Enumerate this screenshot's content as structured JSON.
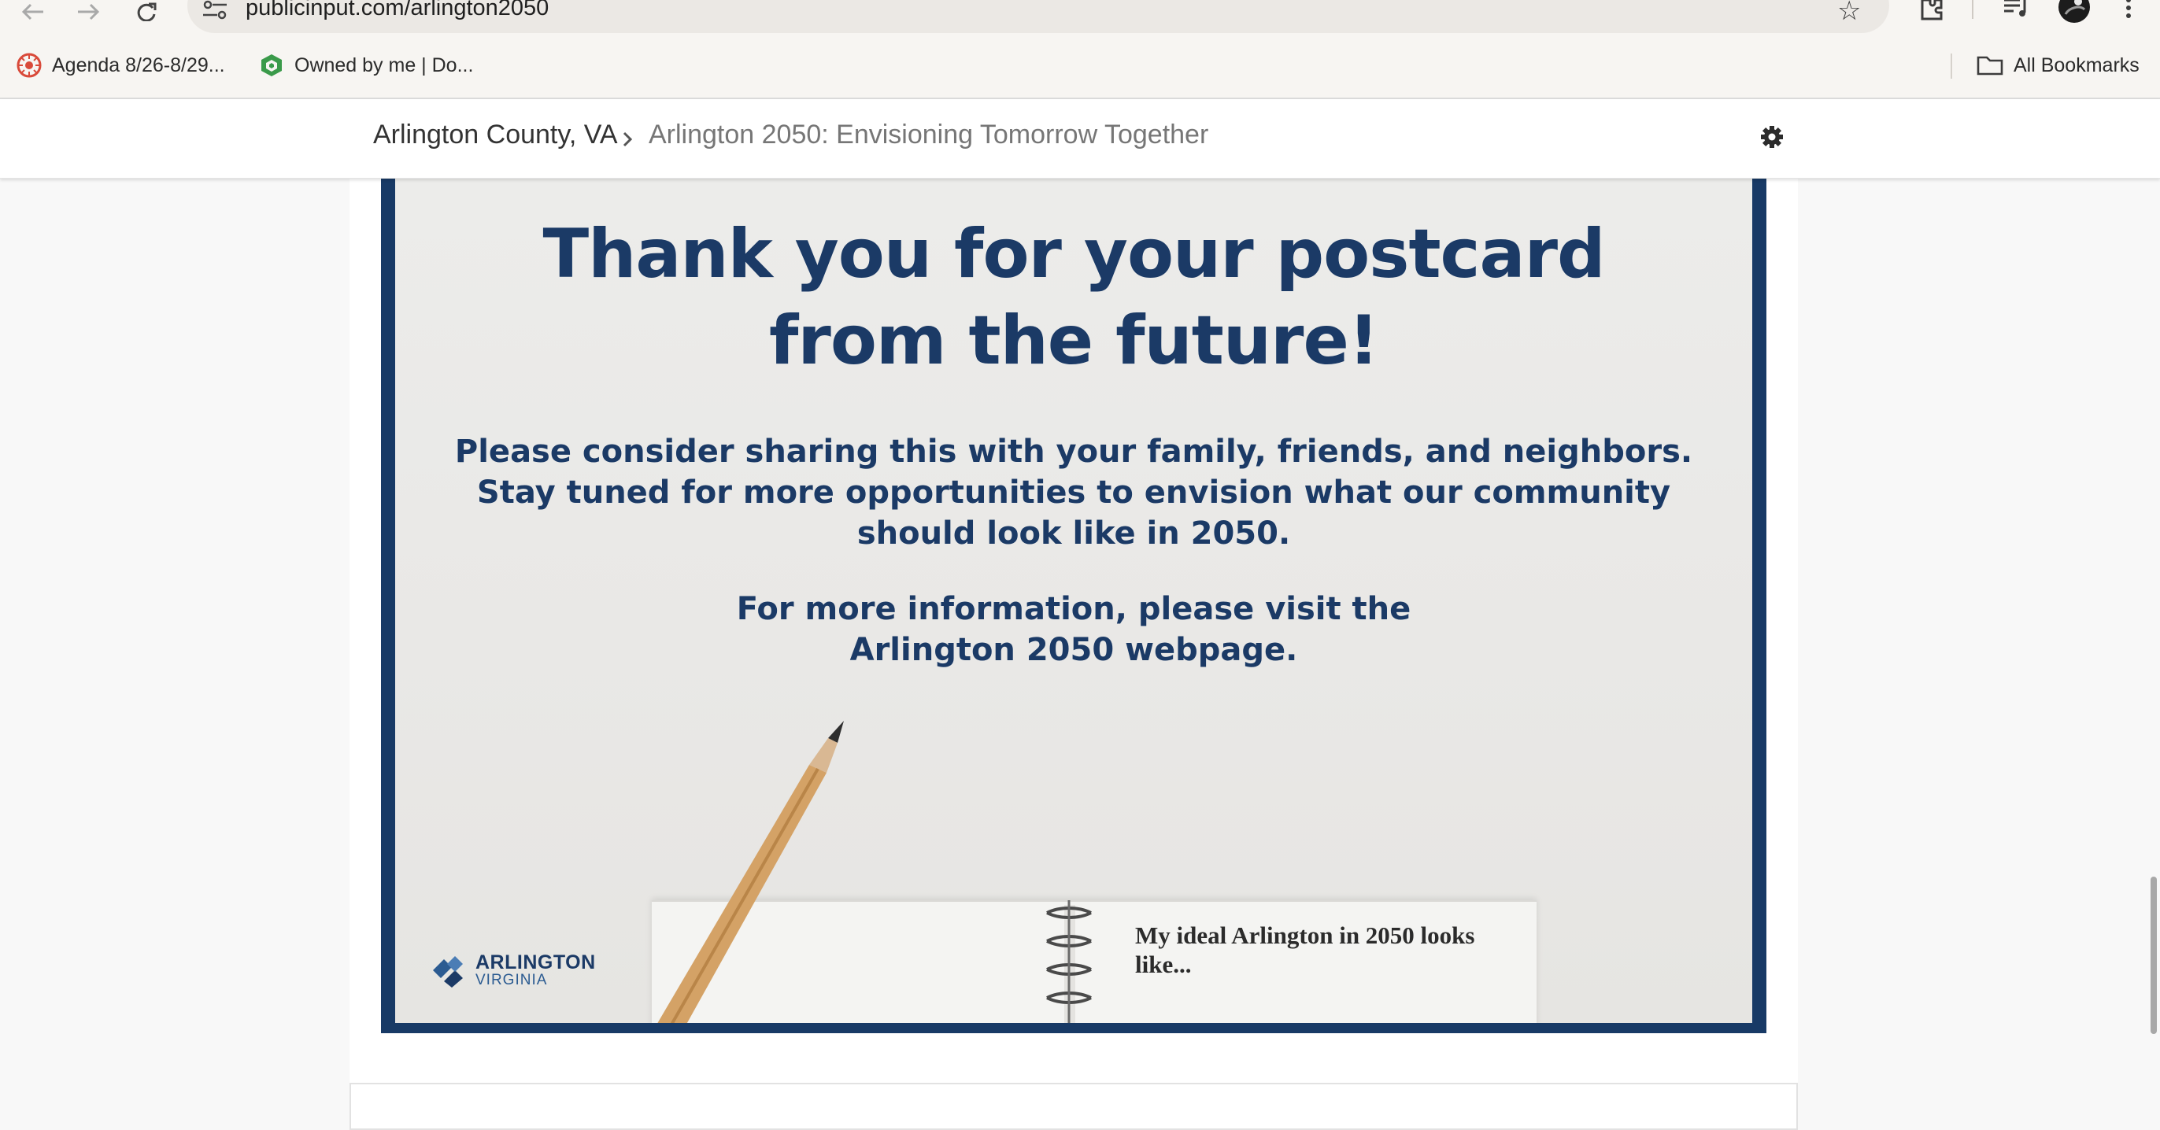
{
  "browser": {
    "url": "publicinput.com/arlington2050",
    "bookmarks": [
      {
        "label": "Agenda 8/26-8/29...",
        "icon": "calendar-app-icon"
      },
      {
        "label": "Owned by me | Do...",
        "icon": "drive-app-icon"
      }
    ],
    "all_bookmarks_label": "All Bookmarks"
  },
  "site_header": {
    "org": "Arlington County, VA",
    "project": "Arlington 2050: Envisioning Tomorrow Together"
  },
  "postcard": {
    "title_line1": "Thank you for your postcard",
    "title_line2": "from the future!",
    "body_line1": "Please consider sharing this with your family, friends, and neighbors.",
    "body_line2": "Stay tuned for more opportunities to envision what our community",
    "body_line3": "should look like in 2050.",
    "info_line1": "For more information, please visit the",
    "info_line2": "Arlington 2050 webpage.",
    "notebook_caption": "My ideal Arlington in 2050 looks like...",
    "logo_main": "ARLINGTON",
    "logo_sub": "VIRGINIA"
  },
  "colors": {
    "brand_navy": "#1b3a66",
    "card_frame": "#183a66",
    "header_bg": "#ffffff",
    "page_bg": "#f8f8f8"
  }
}
